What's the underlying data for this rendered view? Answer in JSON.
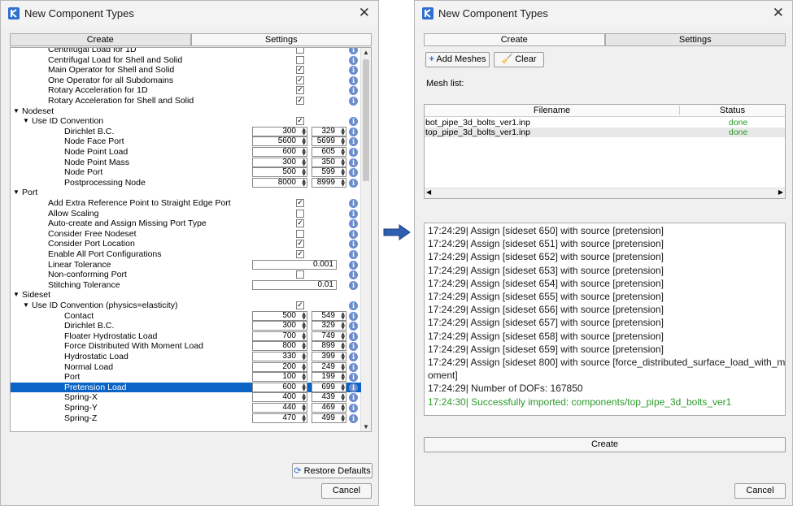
{
  "left_dialog": {
    "title": "New Component Types",
    "tabs": [
      "Create",
      "Settings"
    ],
    "tree_rows": [
      {
        "label": "Centrifugal Load for 1D",
        "indent": 2,
        "check": false
      },
      {
        "label": "Centrifugal Load for Shell and Solid",
        "indent": 2,
        "check": false
      },
      {
        "label": "Main Operator for Shell and Solid",
        "indent": 2,
        "check": true
      },
      {
        "label": "One Operator for all Subdomains",
        "indent": 2,
        "check": true
      },
      {
        "label": "Rotary Acceleration for 1D",
        "indent": 2,
        "check": true
      },
      {
        "label": "Rotary Acceleration for Shell and Solid",
        "indent": 2,
        "check": true
      },
      {
        "label": "Nodeset",
        "indent": 0,
        "expander": true
      },
      {
        "label": "Use ID Convention",
        "indent": 1,
        "expander": true,
        "check": true
      },
      {
        "label": "Dirichlet B.C.",
        "indent": 3,
        "v1": "300",
        "v2": "329"
      },
      {
        "label": "Node Face Port",
        "indent": 3,
        "v1": "5600",
        "v2": "5699"
      },
      {
        "label": "Node Point Load",
        "indent": 3,
        "v1": "600",
        "v2": "605"
      },
      {
        "label": "Node Point Mass",
        "indent": 3,
        "v1": "300",
        "v2": "350"
      },
      {
        "label": "Node Port",
        "indent": 3,
        "v1": "500",
        "v2": "599"
      },
      {
        "label": "Postprocessing Node",
        "indent": 3,
        "v1": "8000",
        "v2": "8999"
      },
      {
        "label": "Port",
        "indent": 0,
        "expander": true
      },
      {
        "label": "Add Extra Reference Point to Straight Edge Port",
        "indent": 2,
        "check": true
      },
      {
        "label": "Allow Scaling",
        "indent": 2,
        "check": false
      },
      {
        "label": "Auto-create and Assign Missing Port Type",
        "indent": 2,
        "check": true
      },
      {
        "label": "Consider Free Nodeset",
        "indent": 2,
        "check": false
      },
      {
        "label": "Consider Port Location",
        "indent": 2,
        "check": true
      },
      {
        "label": "Enable All Port Configurations",
        "indent": 2,
        "check": true
      },
      {
        "label": "Linear Tolerance",
        "indent": 2,
        "num": "0.001"
      },
      {
        "label": "Non-conforming Port",
        "indent": 2,
        "check": false
      },
      {
        "label": "Stitching Tolerance",
        "indent": 2,
        "num": "0.01"
      },
      {
        "label": "Sideset",
        "indent": 0,
        "expander": true
      },
      {
        "label": "Use ID Convention (physics=elasticity)",
        "indent": 1,
        "expander": true,
        "check": true
      },
      {
        "label": "Contact",
        "indent": 3,
        "v1": "500",
        "v2": "549"
      },
      {
        "label": "Dirichlet B.C.",
        "indent": 3,
        "v1": "300",
        "v2": "329"
      },
      {
        "label": "Floater Hydrostatic Load",
        "indent": 3,
        "v1": "700",
        "v2": "749"
      },
      {
        "label": "Force Distributed With Moment Load",
        "indent": 3,
        "v1": "800",
        "v2": "899"
      },
      {
        "label": "Hydrostatic Load",
        "indent": 3,
        "v1": "330",
        "v2": "399"
      },
      {
        "label": "Normal Load",
        "indent": 3,
        "v1": "200",
        "v2": "249"
      },
      {
        "label": "Port",
        "indent": 3,
        "v1": "100",
        "v2": "199"
      },
      {
        "label": "Pretension Load",
        "indent": 3,
        "v1": "600",
        "v2": "699",
        "selected": true
      },
      {
        "label": "Spring-X",
        "indent": 3,
        "v1": "400",
        "v2": "439"
      },
      {
        "label": "Spring-Y",
        "indent": 3,
        "v1": "440",
        "v2": "469"
      },
      {
        "label": "Spring-Z",
        "indent": 3,
        "v1": "470",
        "v2": "499"
      }
    ],
    "restore_defaults": "Restore Defaults",
    "cancel": "Cancel"
  },
  "right_dialog": {
    "title": "New Component Types",
    "tabs": [
      "Create",
      "Settings"
    ],
    "add_meshes": "Add Meshes",
    "clear": "Clear",
    "mesh_list_label": "Mesh list:",
    "table_headers": [
      "Filename",
      "Status"
    ],
    "table_rows": [
      {
        "filename": "bot_pipe_3d_bolts_ver1.inp",
        "status": "done"
      },
      {
        "filename": "top_pipe_3d_bolts_ver1.inp",
        "status": "done"
      }
    ],
    "log_lines": [
      "17:24:29| Assign [sideset 650] with source [pretension]",
      "17:24:29| Assign [sideset 651] with source [pretension]",
      "17:24:29| Assign [sideset 652] with source [pretension]",
      "17:24:29| Assign [sideset 653] with source [pretension]",
      "17:24:29| Assign [sideset 654] with source [pretension]",
      "17:24:29| Assign [sideset 655] with source [pretension]",
      "17:24:29| Assign [sideset 656] with source [pretension]",
      "17:24:29| Assign [sideset 657] with source [pretension]",
      "17:24:29| Assign [sideset 658] with source [pretension]",
      "17:24:29| Assign [sideset 659] with source [pretension]",
      "17:24:29| Assign [sideset 800] with source [force_distributed_surface_load_with_m",
      "oment]",
      "17:24:29| Number of DOFs: 167850",
      "17:24:30| Successfully imported: components/top_pipe_3d_bolts_ver1"
    ],
    "success_color": "#2a9a2a",
    "create": "Create",
    "cancel": "Cancel"
  },
  "colors": {
    "selection": "#0a63c5",
    "status_done": "#2a9a2a",
    "info_icon": "#6b8ccf",
    "arrow": "#2f5fb0"
  }
}
